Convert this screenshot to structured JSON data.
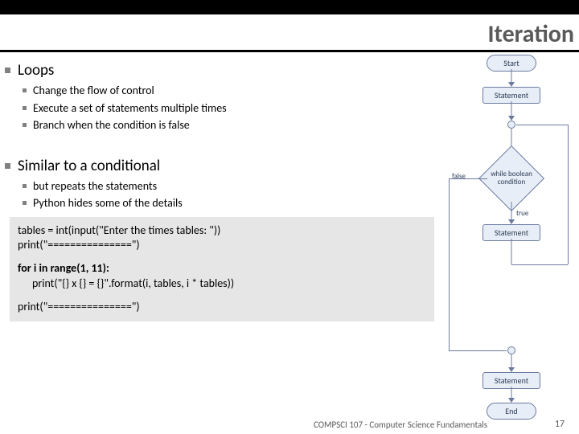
{
  "slide": {
    "title": "Iteration",
    "sections": [
      {
        "heading": "Loops",
        "items": [
          "Change the flow of control",
          "Execute a set of statements multiple times",
          "Branch when the condition is false"
        ]
      },
      {
        "heading": "Similar to a conditional",
        "items": [
          "but repeats the statements",
          "Python hides some of the details"
        ]
      }
    ],
    "code": {
      "line1": "tables = int(input(\"Enter the times tables: \"))",
      "line2": "print(\"===============\")",
      "line3": "for i in range(1, 11):",
      "line4": "print(\"{} x {} = {}\".format(i, tables, i * tables))",
      "line5": "print(\"===============\")"
    },
    "flow": {
      "start": "Start",
      "stmt": "Statement",
      "cond1": "while boolean",
      "cond2": "condition",
      "false": "false",
      "true": "true",
      "end": "End"
    }
  },
  "footer": {
    "course": "COMPSCI 107 - Computer Science Fundamentals",
    "page": "17"
  }
}
